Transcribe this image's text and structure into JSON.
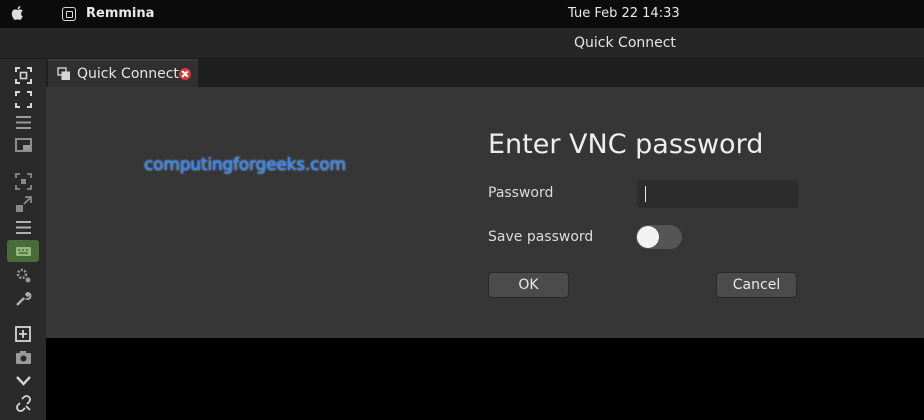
{
  "menubar": {
    "apple_icon": "apple-logo-icon",
    "app_name": "Remmina",
    "clock": "Tue Feb 22  14:33"
  },
  "window": {
    "title": "Quick Connect"
  },
  "toolbar": {
    "items": [
      {
        "icon": "fullscreen-toggle-icon"
      },
      {
        "icon": "fit-window-icon"
      },
      {
        "icon": "menu-lines-icon"
      },
      {
        "icon": "multi-monitor-icon"
      },
      {
        "icon": "dynamic-resolution-icon"
      },
      {
        "icon": "scale-icon"
      },
      {
        "icon": "menu-list-icon"
      },
      {
        "icon": "keyboard-grab-icon",
        "active": true
      },
      {
        "icon": "preferences-icon"
      },
      {
        "icon": "tools-icon"
      },
      {
        "icon": "duplicate-icon"
      },
      {
        "icon": "screenshot-icon"
      },
      {
        "icon": "minimize-icon"
      },
      {
        "icon": "disconnect-icon"
      }
    ]
  },
  "tab": {
    "label": "Quick Connect"
  },
  "watermark": "computingforgeeks.com",
  "dialog": {
    "title": "Enter VNC password",
    "password_label": "Password",
    "password_value": "",
    "save_password_label": "Save password",
    "save_password_on": false,
    "ok_label": "OK",
    "cancel_label": "Cancel"
  },
  "colors": {
    "accent_active": "#4a6b3a",
    "close_red": "#d03a3a",
    "watermark_blue": "#2f86ff"
  }
}
